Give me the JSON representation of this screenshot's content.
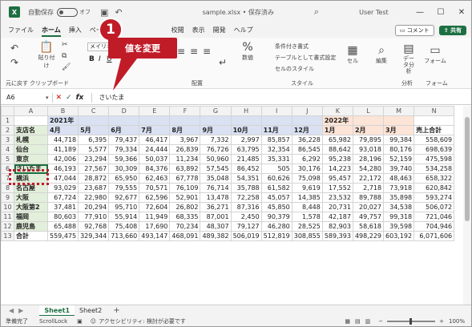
{
  "title_bar": {
    "autosave_label": "自動保存",
    "autosave_state": "オフ",
    "file_name": "sample.xlsx • 保存済み",
    "user": "User Test",
    "min_label": "—",
    "max_label": "☐",
    "close_label": "✕"
  },
  "menu": {
    "items": [
      "ファイル",
      "ホーム",
      "挿入",
      "ページ",
      "校閲",
      "表示",
      "開発",
      "ヘルプ"
    ],
    "comment_label": "コメント",
    "share_label": "共有"
  },
  "ribbon": {
    "undo_group": "元に戻す",
    "clipboard_group": "クリップボード",
    "paste_label": "貼り付け",
    "font_name": "メイリオ",
    "bold": "B",
    "italic": "I",
    "underline": "U",
    "alignment_group": "配置",
    "number_label": "数値",
    "percent": "%",
    "cond_format": "条件付き書式",
    "table_format": "テーブルとして書式設定",
    "cell_style": "セルのスタイル",
    "style_group": "スタイル",
    "cells_label": "セル",
    "edit_label": "編集",
    "data_analysis": "データ分析",
    "analysis_group": "分析",
    "form_label": "フォーム",
    "form_group": "フォーム"
  },
  "formula_bar": {
    "name_box": "A6",
    "cancel": "✕",
    "enter": "✓",
    "fx": "fx",
    "value": "さいたま"
  },
  "grid": {
    "columns": [
      "A",
      "B",
      "C",
      "D",
      "E",
      "F",
      "G",
      "H",
      "I",
      "J",
      "K",
      "L",
      "M",
      "N"
    ],
    "rows": [
      [
        "",
        "2021年",
        "",
        "",
        "",
        "",
        "",
        "",
        "",
        "",
        "2022年",
        "",
        "",
        ""
      ],
      [
        "支店名",
        "4月",
        "5月",
        "6月",
        "7月",
        "8月",
        "9月",
        "10月",
        "11月",
        "12月",
        "1月",
        "2月",
        "3月",
        "売上合計"
      ],
      [
        "札幌",
        "44,718",
        "6,395",
        "79,437",
        "46,417",
        "3,967",
        "7,332",
        "2,997",
        "85,857",
        "36,228",
        "65,982",
        "79,895",
        "99,384",
        "558,609"
      ],
      [
        "仙台",
        "41,189",
        "5,577",
        "79,334",
        "24,444",
        "26,839",
        "76,726",
        "63,795",
        "32,354",
        "86,545",
        "88,642",
        "93,018",
        "80,176",
        "698,639"
      ],
      [
        "東京",
        "42,006",
        "23,294",
        "59,366",
        "50,037",
        "11,234",
        "50,960",
        "21,485",
        "35,331",
        "6,292",
        "95,238",
        "28,196",
        "52,159",
        "475,598"
      ],
      [
        "さいたま",
        "46,193",
        "27,567",
        "30,309",
        "84,376",
        "63,892",
        "57,545",
        "86,452",
        "505",
        "30,176",
        "14,223",
        "54,280",
        "39,740",
        "534,258"
      ],
      [
        "横浜",
        "47,044",
        "28,872",
        "65,950",
        "62,463",
        "67,778",
        "35,048",
        "54,351",
        "60,626",
        "75,098",
        "95,457",
        "22,172",
        "48,463",
        "658,322"
      ],
      [
        "名古屋",
        "93,029",
        "23,687",
        "79,555",
        "70,571",
        "76,109",
        "76,714",
        "35,788",
        "61,582",
        "9,619",
        "17,552",
        "2,718",
        "73,918",
        "620,842"
      ],
      [
        "大阪",
        "67,724",
        "22,980",
        "92,677",
        "62,596",
        "52,901",
        "13,478",
        "72,258",
        "45,057",
        "14,385",
        "23,532",
        "89,788",
        "35,898",
        "593,274"
      ],
      [
        "大阪第2",
        "37,481",
        "20,294",
        "95,710",
        "72,604",
        "26,802",
        "36,271",
        "87,316",
        "45,850",
        "8,448",
        "20,731",
        "20,027",
        "34,538",
        "506,072"
      ],
      [
        "福岡",
        "80,603",
        "77,910",
        "55,914",
        "11,949",
        "68,335",
        "87,001",
        "2,450",
        "90,379",
        "1,578",
        "42,187",
        "49,757",
        "99,318",
        "721,046"
      ],
      [
        "鹿児島",
        "65,488",
        "92,768",
        "75,408",
        "17,690",
        "70,234",
        "48,307",
        "79,127",
        "46,280",
        "28,525",
        "82,903",
        "58,618",
        "39,598",
        "704,946"
      ],
      [
        "合計",
        "559,475",
        "329,344",
        "713,660",
        "493,147",
        "468,091",
        "489,382",
        "506,019",
        "512,819",
        "308,855",
        "589,393",
        "498,229",
        "603,192",
        "6,071,606"
      ]
    ]
  },
  "sheets": {
    "tabs": [
      "Sheet1",
      "Sheet2"
    ],
    "add": "+"
  },
  "status": {
    "mode": "準備完了",
    "scroll_lock": "ScrollLock",
    "accessibility": "アクセシビリティ: 検討が必要です",
    "zoom": "100%"
  },
  "callout": {
    "number": "1",
    "text": "値を変更"
  }
}
